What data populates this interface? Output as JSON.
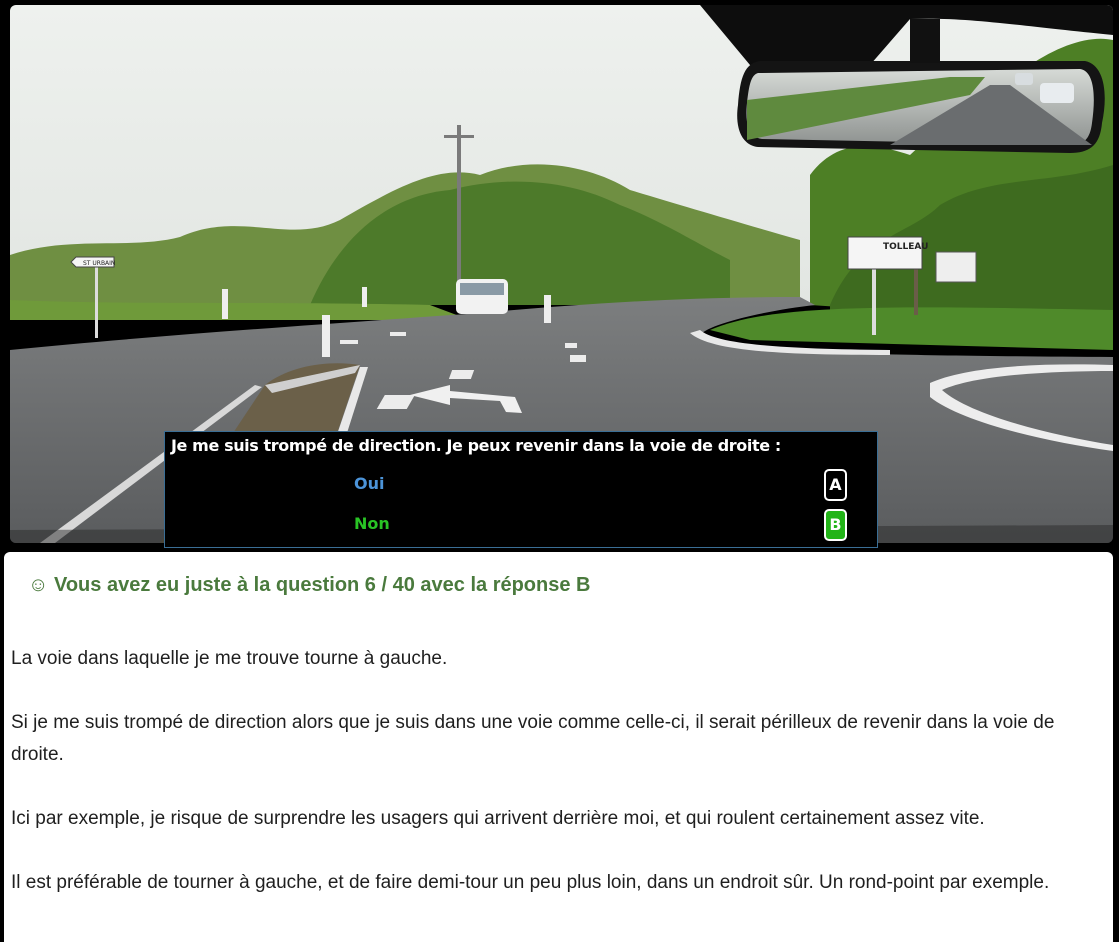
{
  "question": {
    "text": "Je me suis trompé de direction. Je peux revenir dans la voie de droite :",
    "answers": [
      {
        "key": "A",
        "label": "Oui",
        "color": "#4c94d9",
        "selected": false
      },
      {
        "key": "B",
        "label": "Non",
        "color": "#29c425",
        "selected": true
      }
    ]
  },
  "result": {
    "icon": "smiley-icon",
    "text": "☺ Vous avez eu juste à la question 6 / 40 avec la réponse B",
    "color": "#4a7a3d"
  },
  "explanation": [
    "La voie dans laquelle je me trouve tourne à gauche.",
    "Si je me suis trompé de direction alors que je suis dans une voie comme celle-ci, il serait périlleux de revenir dans la voie de droite.",
    "Ici par exemple, je risque de surprendre les usagers qui arrivent derrière moi, et qui roulent certainement assez vite.",
    "Il est préférable de tourner à gauche, et de faire demi-tour un peu plus loin, dans un endroit sûr. Un rond-point par exemple."
  ],
  "signs": {
    "sign_left": "ST URBAIN",
    "sign_right": "TOLLEAU"
  }
}
